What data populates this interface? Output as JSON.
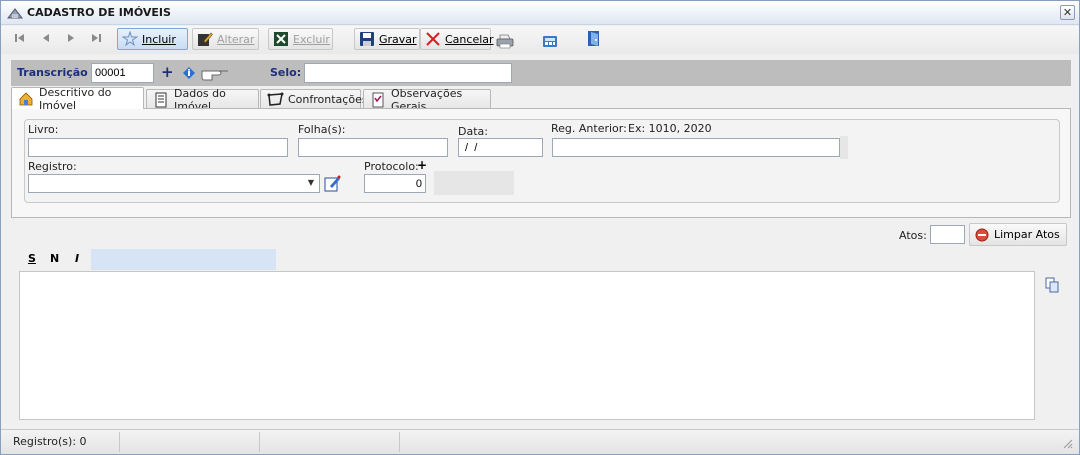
{
  "window": {
    "title": "CADASTRO DE IMÓVEIS",
    "close_label": "✕"
  },
  "toolbar": {
    "nav": [
      "⏮",
      "◀",
      "▶",
      "⏭"
    ],
    "incluir_label": "Incluir",
    "alterar_label": "Alterar",
    "excluir_label": "Excluir",
    "gravar_label": "Gravar",
    "cancelar_label": "Cancelar",
    "icons": [
      "printer-icon",
      "calculator-icon",
      "exit-door-icon"
    ]
  },
  "header": {
    "transcricao_label": "Transcrição",
    "transcricao_value": "00001",
    "plus": "+",
    "selo_label": "Selo:",
    "selo_value": ""
  },
  "tabs": [
    {
      "label": "Descritivo do Imóvel",
      "icon": "house-icon",
      "selected": true
    },
    {
      "label": "Dados do Imóvel",
      "icon": "document-icon",
      "selected": false
    },
    {
      "label": "Confrontações",
      "icon": "boundary-icon",
      "selected": false
    },
    {
      "label": "Observações Gerais",
      "icon": "notes-icon",
      "selected": false
    }
  ],
  "form": {
    "livro_label": "Livro:",
    "livro_value": "",
    "folha_label": "Folha(s):",
    "folha_value": "",
    "data_label": "Data:",
    "data_value": " /  /",
    "reg_anterior_label": "Reg. Anterior:",
    "reg_anterior_hint": "Ex: 1010, 2020",
    "reg_anterior_value": "",
    "registro_label": "Registro:",
    "registro_value": "",
    "protocolo_label": "Protocolo:",
    "protocolo_plus": "+",
    "protocolo_value": "0"
  },
  "atos": {
    "label": "Atos:",
    "value": "",
    "limpar_label": "Limpar Atos"
  },
  "format": {
    "s": "S",
    "n": "N",
    "i": "I"
  },
  "memo": {
    "text": ""
  },
  "status": {
    "registros": "Registro(s): 0"
  },
  "colors": {
    "title_bar": "#dfe7f2",
    "header_bg": "#bdbdbd",
    "label_blue": "#1c2f7a",
    "highlight": "#d7e4f5"
  }
}
